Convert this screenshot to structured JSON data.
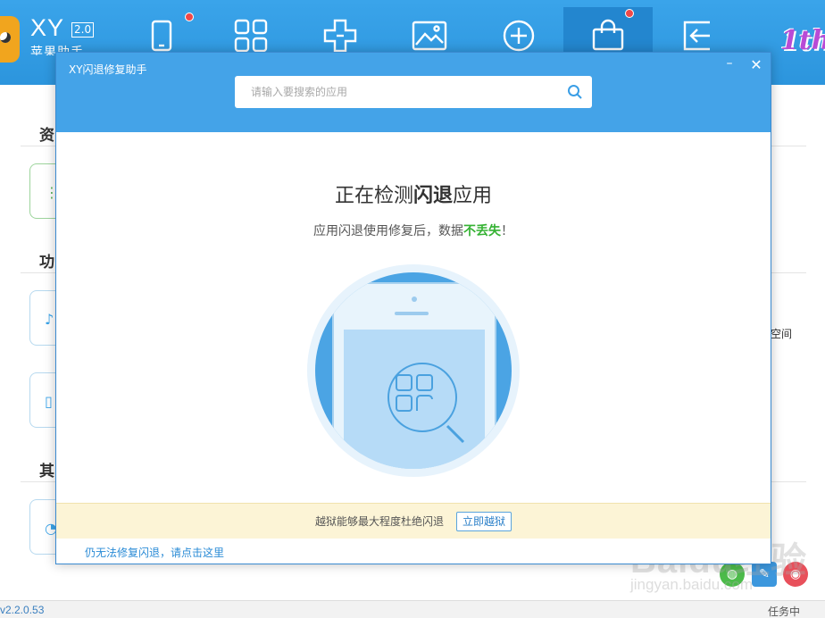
{
  "app": {
    "name": "XY",
    "version_badge": "2.0",
    "subtitle": "苹果助手",
    "right_text": "空间",
    "version_status": "v2.2.0.53",
    "task_text": "任务中"
  },
  "promo": {
    "text": "1th"
  },
  "toolbar": [
    {
      "icon": "phone-icon",
      "badge": true
    },
    {
      "icon": "apps-grid-icon",
      "badge": false
    },
    {
      "icon": "cross-plus-icon",
      "badge": false
    },
    {
      "icon": "image-icon",
      "badge": false
    },
    {
      "icon": "add-circle-icon",
      "badge": false
    },
    {
      "icon": "shopping-bag-icon",
      "badge": true,
      "active": true
    },
    {
      "icon": "exit-icon",
      "badge": false
    }
  ],
  "sections": [
    "资",
    "功",
    "其"
  ],
  "dialog": {
    "title": "XY闪退修复助手",
    "min_glyph": "–",
    "close_glyph": "✕",
    "search": {
      "placeholder": "请输入要搜索的应用",
      "value": ""
    },
    "heading_pre": "正在检测",
    "heading_bold": "闪退",
    "heading_post": "应用",
    "sub_pre": "应用闪退使用修复后，数据",
    "sub_highlight": "不丢失",
    "sub_post": "！",
    "bottom_message": "越狱能够最大程度杜绝闪退",
    "jailbreak_button": "立即越狱",
    "fail_link": "仍无法修复闪退，请点击这里"
  },
  "watermark": {
    "text": "Baidu经验",
    "sub": "jingyan.baidu.com"
  },
  "colors": {
    "header_blue": "#44a3e8",
    "accent_green": "#35b233",
    "banner_yellow": "#fcf4d6",
    "link_blue": "#2a8bd6"
  }
}
